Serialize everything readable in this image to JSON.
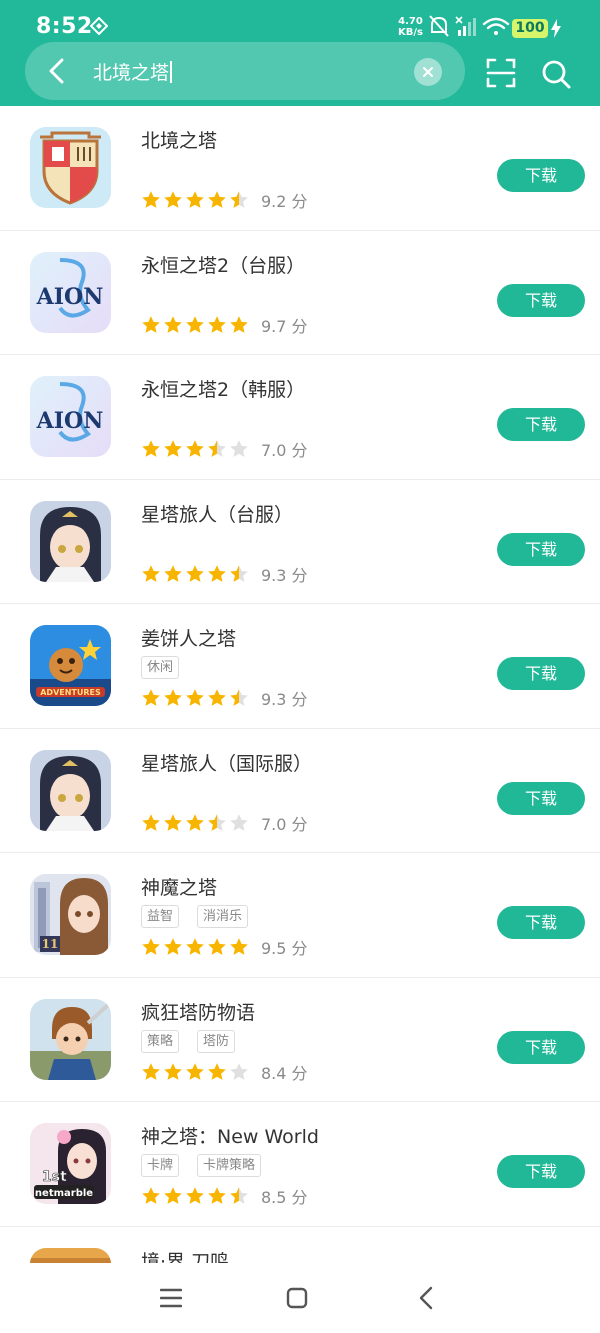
{
  "status_bar": {
    "time": "8:52",
    "net_speed_value": "4.70",
    "net_speed_unit": "KB/s",
    "battery": "100"
  },
  "search": {
    "query": "北境之塔"
  },
  "apps": [
    {
      "name": "北境之塔",
      "tags": [],
      "rating": 4.5,
      "score": "9.2 分",
      "button": "下载",
      "icon": "castle-crest-icon"
    },
    {
      "name": "永恒之塔2（台服）",
      "tags": [],
      "rating": 5,
      "score": "9.7 分",
      "button": "下载",
      "icon": "aion-logo-icon"
    },
    {
      "name": "永恒之塔2（韩服）",
      "tags": [],
      "rating": 3.5,
      "score": "7.0 分",
      "button": "下载",
      "icon": "aion-logo-icon"
    },
    {
      "name": "星塔旅人（台服）",
      "tags": [],
      "rating": 4.5,
      "score": "9.3 分",
      "button": "下载",
      "icon": "anime-girl-icon"
    },
    {
      "name": "姜饼人之塔",
      "tags": [
        "休闲"
      ],
      "rating": 4.5,
      "score": "9.3 分",
      "button": "下载",
      "icon": "cookie-adventures-icon"
    },
    {
      "name": "星塔旅人（国际服）",
      "tags": [],
      "rating": 3.5,
      "score": "7.0 分",
      "button": "下载",
      "icon": "anime-girl-icon"
    },
    {
      "name": "神魔之塔",
      "tags": [
        "益智",
        "消消乐"
      ],
      "rating": 5,
      "score": "9.5 分",
      "button": "下载",
      "icon": "tower-girl-icon"
    },
    {
      "name": "疯狂塔防物语",
      "tags": [
        "策略",
        "塔防"
      ],
      "rating": 4,
      "score": "8.4 分",
      "button": "下载",
      "icon": "warrior-boy-icon"
    },
    {
      "name": "神之塔：New World",
      "tags": [
        "卡牌",
        "卡牌策略"
      ],
      "rating": 4.5,
      "score": "8.5 分",
      "button": "下载",
      "icon": "netmarble-girl-icon"
    },
    {
      "name": "境·界 刀鸣",
      "tags": [],
      "rating": 0,
      "score": "",
      "button": "",
      "icon": "partial-app-icon"
    }
  ],
  "colors": {
    "brand": "#22b99a",
    "button": "#20b897",
    "star": "#f7b500",
    "star_empty": "#e0e0e0"
  }
}
